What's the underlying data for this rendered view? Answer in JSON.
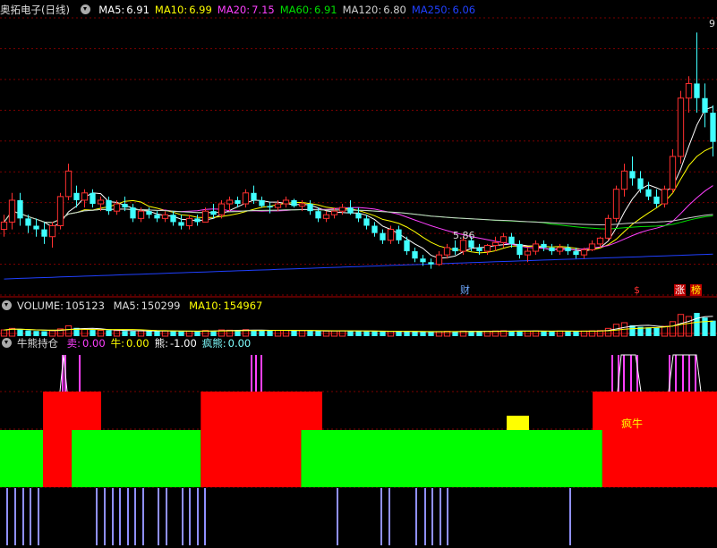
{
  "main": {
    "stock_name": "奥拓电子",
    "period": "(日线)",
    "ma_readouts": [
      {
        "label": "MA5:",
        "value": "6.91",
        "color": "#ffffff"
      },
      {
        "label": "MA10:",
        "value": "6.99",
        "color": "#ffff00"
      },
      {
        "label": "MA20:",
        "value": "7.15",
        "color": "#ff40ff"
      },
      {
        "label": "MA60:",
        "value": "6.91",
        "color": "#00e000"
      },
      {
        "label": "MA120:",
        "value": "6.80",
        "color": "#d0d0d0"
      },
      {
        "label": "MA250:",
        "value": "6.06",
        "color": "#2040ff"
      }
    ],
    "low_label": "5.86",
    "high_label": "9",
    "markers": {
      "cai": "财",
      "dollar": "$",
      "zhang": "涨",
      "bang": "榜"
    }
  },
  "volume": {
    "label": "VOLUME:",
    "value": "105123",
    "ma5_label": "MA5:",
    "ma5_value": "150299",
    "ma10_label": "MA10:",
    "ma10_value": "154967"
  },
  "indicator": {
    "name": "牛熊持仓",
    "items": [
      {
        "label": "卖:",
        "value": "0.00",
        "color": "#ff40ff"
      },
      {
        "label": "牛:",
        "value": "0.00",
        "color": "#ffff00"
      },
      {
        "label": "熊:",
        "value": "-1.00",
        "color": "#ffffff"
      },
      {
        "label": "疯熊:",
        "value": "0.00",
        "color": "#80ffff"
      }
    ],
    "crazy_bull_label": "疯牛"
  },
  "colors": {
    "up": "#ff3030",
    "down": "#40ffff",
    "grid": "#7a0000",
    "bull": "#ff0000",
    "bear": "#00ff00",
    "sell": "#ff40ff",
    "bearline": "#9090ff",
    "yellow": "#ffff00"
  },
  "chart_data": {
    "type": "candlestick",
    "price_axis": {
      "ylim": [
        5.5,
        9.3
      ]
    },
    "candles_ohlc": [
      [
        6.4,
        6.6,
        6.3,
        6.5
      ],
      [
        6.5,
        6.9,
        6.4,
        6.8
      ],
      [
        6.8,
        6.9,
        6.45,
        6.55
      ],
      [
        6.55,
        6.6,
        6.35,
        6.45
      ],
      [
        6.45,
        6.55,
        6.3,
        6.4
      ],
      [
        6.4,
        6.5,
        6.2,
        6.3
      ],
      [
        6.3,
        6.5,
        6.15,
        6.45
      ],
      [
        6.45,
        6.9,
        6.4,
        6.85
      ],
      [
        6.85,
        7.3,
        6.8,
        7.2
      ],
      [
        6.9,
        7.0,
        6.7,
        6.8
      ],
      [
        6.8,
        6.95,
        6.7,
        6.9
      ],
      [
        6.9,
        6.95,
        6.7,
        6.75
      ],
      [
        6.75,
        6.85,
        6.65,
        6.8
      ],
      [
        6.8,
        6.85,
        6.6,
        6.65
      ],
      [
        6.65,
        6.8,
        6.6,
        6.75
      ],
      [
        6.75,
        6.85,
        6.65,
        6.7
      ],
      [
        6.7,
        6.75,
        6.5,
        6.55
      ],
      [
        6.55,
        6.7,
        6.5,
        6.65
      ],
      [
        6.65,
        6.7,
        6.55,
        6.6
      ],
      [
        6.6,
        6.65,
        6.5,
        6.55
      ],
      [
        6.55,
        6.65,
        6.5,
        6.6
      ],
      [
        6.6,
        6.65,
        6.45,
        6.5
      ],
      [
        6.5,
        6.6,
        6.4,
        6.45
      ],
      [
        6.45,
        6.6,
        6.4,
        6.55
      ],
      [
        6.55,
        6.6,
        6.45,
        6.5
      ],
      [
        6.5,
        6.7,
        6.5,
        6.65
      ],
      [
        6.65,
        6.75,
        6.55,
        6.6
      ],
      [
        6.6,
        6.8,
        6.55,
        6.75
      ],
      [
        6.75,
        6.85,
        6.65,
        6.8
      ],
      [
        6.8,
        6.85,
        6.7,
        6.75
      ],
      [
        6.75,
        6.95,
        6.7,
        6.9
      ],
      [
        6.9,
        7.0,
        6.75,
        6.8
      ],
      [
        6.8,
        6.85,
        6.7,
        6.72
      ],
      [
        6.72,
        6.78,
        6.62,
        6.7
      ],
      [
        6.7,
        6.8,
        6.65,
        6.75
      ],
      [
        6.75,
        6.85,
        6.7,
        6.8
      ],
      [
        6.8,
        6.82,
        6.7,
        6.72
      ],
      [
        6.72,
        6.8,
        6.65,
        6.75
      ],
      [
        6.75,
        6.8,
        6.6,
        6.65
      ],
      [
        6.65,
        6.7,
        6.5,
        6.55
      ],
      [
        6.55,
        6.65,
        6.5,
        6.6
      ],
      [
        6.6,
        6.7,
        6.55,
        6.65
      ],
      [
        6.65,
        6.75,
        6.6,
        6.7
      ],
      [
        6.7,
        6.8,
        6.6,
        6.62
      ],
      [
        6.62,
        6.7,
        6.5,
        6.55
      ],
      [
        6.55,
        6.6,
        6.4,
        6.45
      ],
      [
        6.45,
        6.5,
        6.3,
        6.35
      ],
      [
        6.35,
        6.4,
        6.2,
        6.25
      ],
      [
        6.25,
        6.45,
        6.2,
        6.4
      ],
      [
        6.4,
        6.45,
        6.2,
        6.25
      ],
      [
        6.25,
        6.3,
        6.05,
        6.1
      ],
      [
        6.1,
        6.15,
        5.95,
        6.0
      ],
      [
        6.0,
        6.05,
        5.9,
        5.95
      ],
      [
        5.95,
        6.0,
        5.86,
        5.92
      ],
      [
        5.92,
        6.1,
        5.9,
        6.05
      ],
      [
        6.05,
        6.2,
        6.0,
        6.15
      ],
      [
        6.15,
        6.25,
        6.05,
        6.1
      ],
      [
        6.1,
        6.3,
        6.05,
        6.25
      ],
      [
        6.25,
        6.3,
        6.1,
        6.15
      ],
      [
        6.15,
        6.2,
        6.05,
        6.1
      ],
      [
        6.1,
        6.2,
        6.05,
        6.18
      ],
      [
        6.18,
        6.3,
        6.1,
        6.22
      ],
      [
        6.22,
        6.35,
        6.15,
        6.3
      ],
      [
        6.3,
        6.35,
        6.15,
        6.2
      ],
      [
        6.2,
        6.25,
        6.0,
        6.05
      ],
      [
        6.05,
        6.15,
        5.95,
        6.1
      ],
      [
        6.1,
        6.25,
        6.05,
        6.2
      ],
      [
        6.2,
        6.25,
        6.1,
        6.15
      ],
      [
        6.15,
        6.2,
        6.05,
        6.1
      ],
      [
        6.1,
        6.2,
        6.05,
        6.15
      ],
      [
        6.15,
        6.2,
        6.05,
        6.1
      ],
      [
        6.1,
        6.15,
        6.0,
        6.05
      ],
      [
        6.05,
        6.15,
        6.0,
        6.12
      ],
      [
        6.12,
        6.25,
        6.1,
        6.2
      ],
      [
        6.2,
        6.3,
        6.15,
        6.28
      ],
      [
        6.28,
        6.6,
        6.25,
        6.55
      ],
      [
        6.55,
        7.0,
        6.5,
        6.95
      ],
      [
        6.95,
        7.3,
        6.85,
        7.2
      ],
      [
        7.2,
        7.4,
        7.0,
        7.1
      ],
      [
        7.1,
        7.2,
        6.9,
        6.95
      ],
      [
        6.95,
        7.05,
        6.8,
        6.85
      ],
      [
        6.85,
        6.95,
        6.7,
        6.75
      ],
      [
        6.75,
        7.0,
        6.7,
        6.95
      ],
      [
        6.95,
        7.5,
        6.9,
        7.4
      ],
      [
        7.4,
        8.3,
        7.3,
        8.2
      ],
      [
        8.2,
        8.5,
        8.0,
        8.4
      ],
      [
        8.4,
        9.1,
        8.0,
        8.2
      ],
      [
        8.2,
        8.4,
        7.8,
        8.0
      ],
      [
        8.0,
        8.1,
        7.4,
        7.6
      ]
    ],
    "volume_values": [
      120,
      150,
      130,
      110,
      100,
      95,
      105,
      140,
      200,
      160,
      130,
      120,
      110,
      115,
      105,
      100,
      95,
      100,
      105,
      98,
      100,
      95,
      90,
      95,
      92,
      110,
      105,
      120,
      115,
      110,
      125,
      118,
      108,
      104,
      110,
      112,
      105,
      108,
      100,
      95,
      98,
      100,
      105,
      100,
      96,
      92,
      90,
      88,
      95,
      90,
      86,
      84,
      82,
      80,
      88,
      95,
      92,
      98,
      94,
      90,
      96,
      100,
      104,
      98,
      92,
      95,
      100,
      96,
      94,
      98,
      96,
      94,
      98,
      102,
      108,
      150,
      230,
      260,
      210,
      180,
      170,
      160,
      190,
      280,
      420,
      380,
      450,
      360,
      300
    ],
    "indicator_blocks": [
      {
        "state": "bear",
        "from": 0,
        "to": 3
      },
      {
        "state": "bull",
        "from": 3,
        "to": 5
      },
      {
        "state": "bear",
        "from": 5,
        "to": 14
      },
      {
        "state": "bull",
        "from": 14,
        "to": 21
      },
      {
        "state": "bear",
        "from": 21,
        "to": 42
      },
      {
        "state": "bull",
        "from": 42,
        "to": 50
      }
    ]
  }
}
